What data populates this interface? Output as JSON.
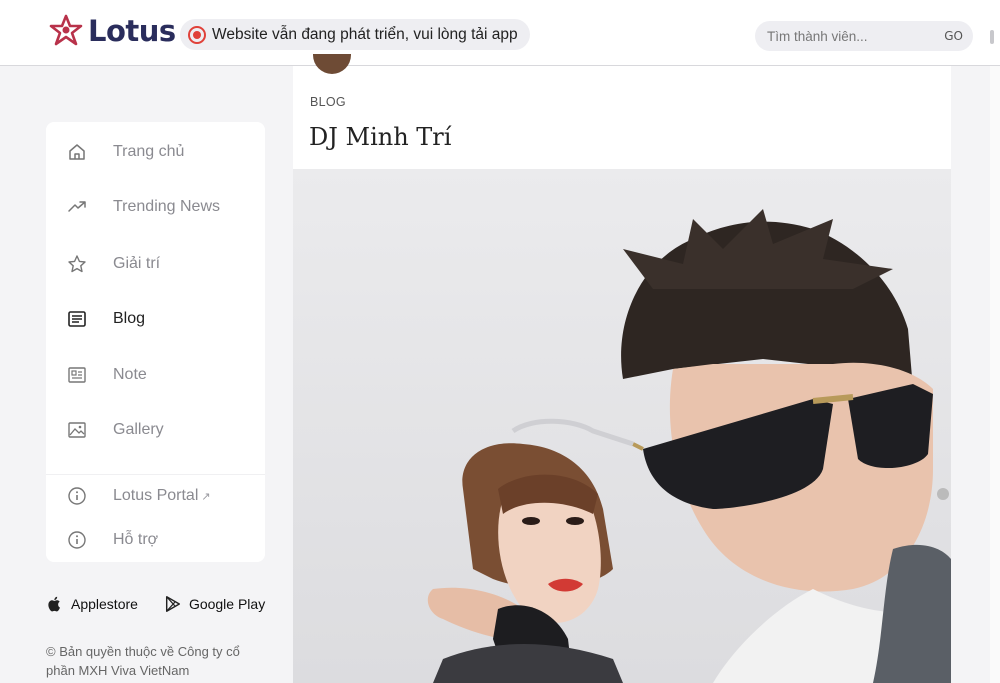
{
  "header": {
    "logo_text": "Lotus",
    "notice": "Website vẫn đang phát triển, vui lòng tải app",
    "search_placeholder": "Tìm thành viên...",
    "search_button": "GO"
  },
  "sidebar": {
    "items": [
      {
        "label": "Trang chủ",
        "icon": "home-icon",
        "active": false
      },
      {
        "label": "Trending News",
        "icon": "trending-icon",
        "active": false
      },
      {
        "label": "Giải trí",
        "icon": "star-icon",
        "active": false
      },
      {
        "label": "Blog",
        "icon": "blog-icon",
        "active": true
      },
      {
        "label": "Note",
        "icon": "note-icon",
        "active": false
      },
      {
        "label": "Gallery",
        "icon": "gallery-icon",
        "active": false
      },
      {
        "label": "Lotus Portal",
        "icon": "info-icon",
        "active": false
      },
      {
        "label": "Hỗ trợ",
        "icon": "info-icon",
        "active": false
      }
    ]
  },
  "stores": {
    "apple": "Applestore",
    "google": "Google Play"
  },
  "copyright": "© Bản quyền thuộc về Công ty cổ phần MXH Viva VietNam",
  "post": {
    "category": "BLOG",
    "title": "DJ Minh Trí"
  },
  "colors": {
    "brand": "#2a2d5c",
    "logo_accent": "#b8324a",
    "record": "#e0413a"
  }
}
